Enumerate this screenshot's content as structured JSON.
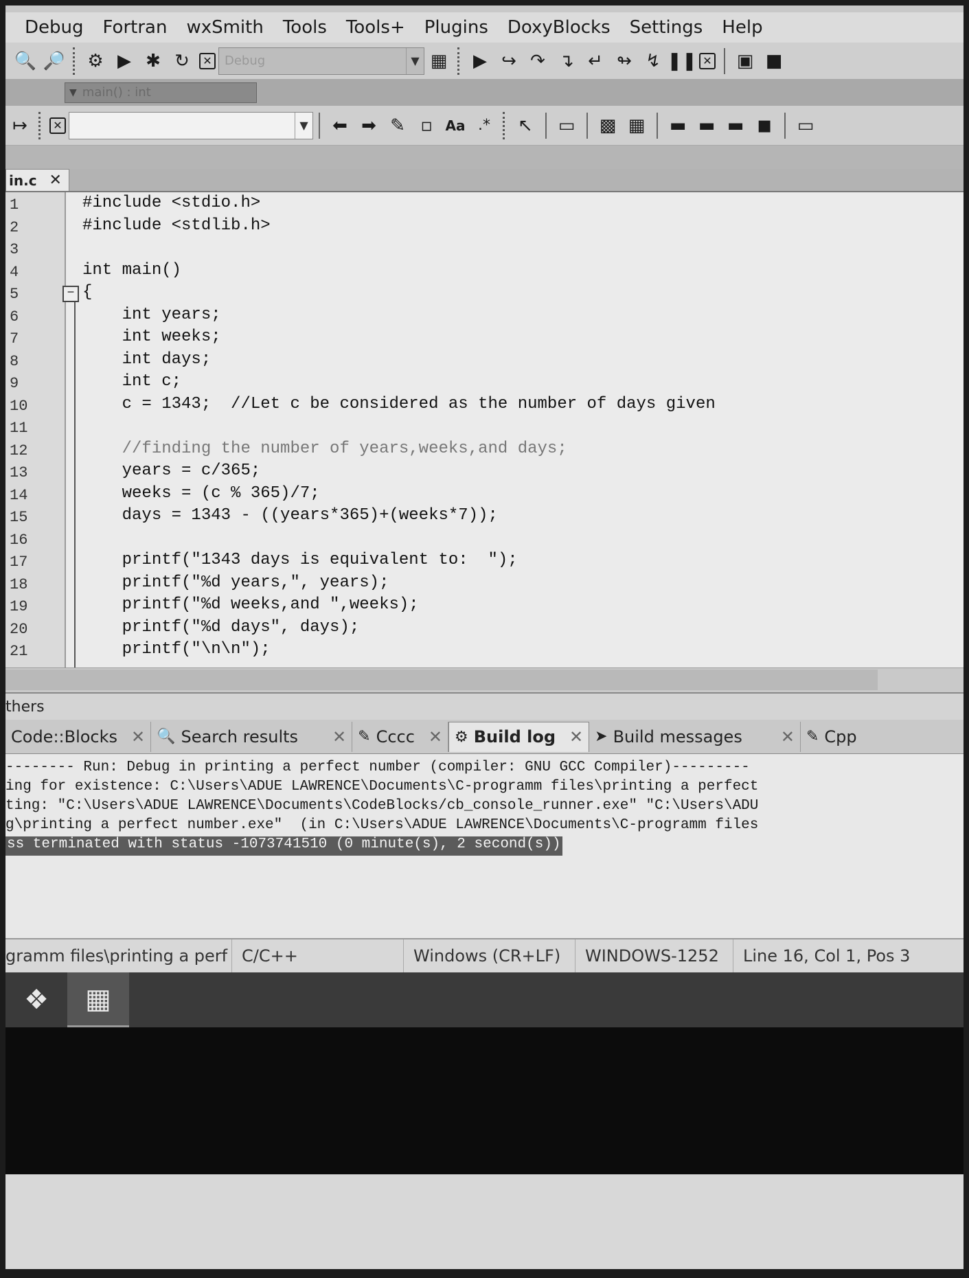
{
  "menu": [
    "Debug",
    "Fortran",
    "wxSmith",
    "Tools",
    "Tools+",
    "Plugins",
    "DoxyBlocks",
    "Settings",
    "Help"
  ],
  "toolbar": {
    "build_target_value": "Debug",
    "scope_value": "main() : int"
  },
  "editor": {
    "file_tab": "in.c",
    "lines": [
      {
        "n": "1",
        "code": "#include <stdio.h>"
      },
      {
        "n": "2",
        "code": "#include <stdlib.h>"
      },
      {
        "n": "3",
        "code": ""
      },
      {
        "n": "4",
        "code": "int main()"
      },
      {
        "n": "5",
        "code": "{"
      },
      {
        "n": "6",
        "code": "    int years;"
      },
      {
        "n": "7",
        "code": "    int weeks;"
      },
      {
        "n": "8",
        "code": "    int days;"
      },
      {
        "n": "9",
        "code": "    int c;"
      },
      {
        "n": "10",
        "code": "    c = 1343;  //Let c be considered as the number of days given"
      },
      {
        "n": "11",
        "code": ""
      },
      {
        "n": "12",
        "code": "    //finding the number of years,weeks,and days;"
      },
      {
        "n": "13",
        "code": "    years = c/365;"
      },
      {
        "n": "14",
        "code": "    weeks = (c % 365)/7;"
      },
      {
        "n": "15",
        "code": "    days = 1343 - ((years*365)+(weeks*7));"
      },
      {
        "n": "16",
        "code": ""
      },
      {
        "n": "17",
        "code": "    printf(\"1343 days is equivalent to:  \");"
      },
      {
        "n": "18",
        "code": "    printf(\"%d years,\", years);"
      },
      {
        "n": "19",
        "code": "    printf(\"%d weeks,and \",weeks);"
      },
      {
        "n": "20",
        "code": "    printf(\"%d days\", days);"
      },
      {
        "n": "21",
        "code": "    printf(\"\\n\\n\");"
      }
    ]
  },
  "logs": {
    "panel_title": "thers",
    "tabs": [
      {
        "label": "Code::Blocks",
        "icon": ""
      },
      {
        "label": "Search results",
        "icon": "search-icon"
      },
      {
        "label": "Cccc",
        "icon": "pencil-icon"
      },
      {
        "label": "Build log",
        "icon": "gear-icon",
        "active": true
      },
      {
        "label": "Build messages",
        "icon": "pin-icon"
      },
      {
        "label": "Cpp",
        "icon": "pencil-icon"
      }
    ],
    "lines": [
      "-------- Run: Debug in printing a perfect number (compiler: GNU GCC Compiler)---------",
      "ing for existence: C:\\Users\\ADUE LAWRENCE\\Documents\\C-programm files\\printing a perfect",
      "ting: \"C:\\Users\\ADUE LAWRENCE\\Documents\\CodeBlocks/cb_console_runner.exe\" \"C:\\Users\\ADU",
      "g\\printing a perfect number.exe\"  (in C:\\Users\\ADUE LAWRENCE\\Documents\\C-programm files",
      "ss terminated with status -1073741510 (0 minute(s), 2 second(s))"
    ]
  },
  "status": {
    "path": "gramm files\\printing a perf",
    "language": "C/C++",
    "line_endings": "Windows (CR+LF)",
    "encoding": "WINDOWS-1252",
    "position": "Line 16, Col 1, Pos 3"
  }
}
